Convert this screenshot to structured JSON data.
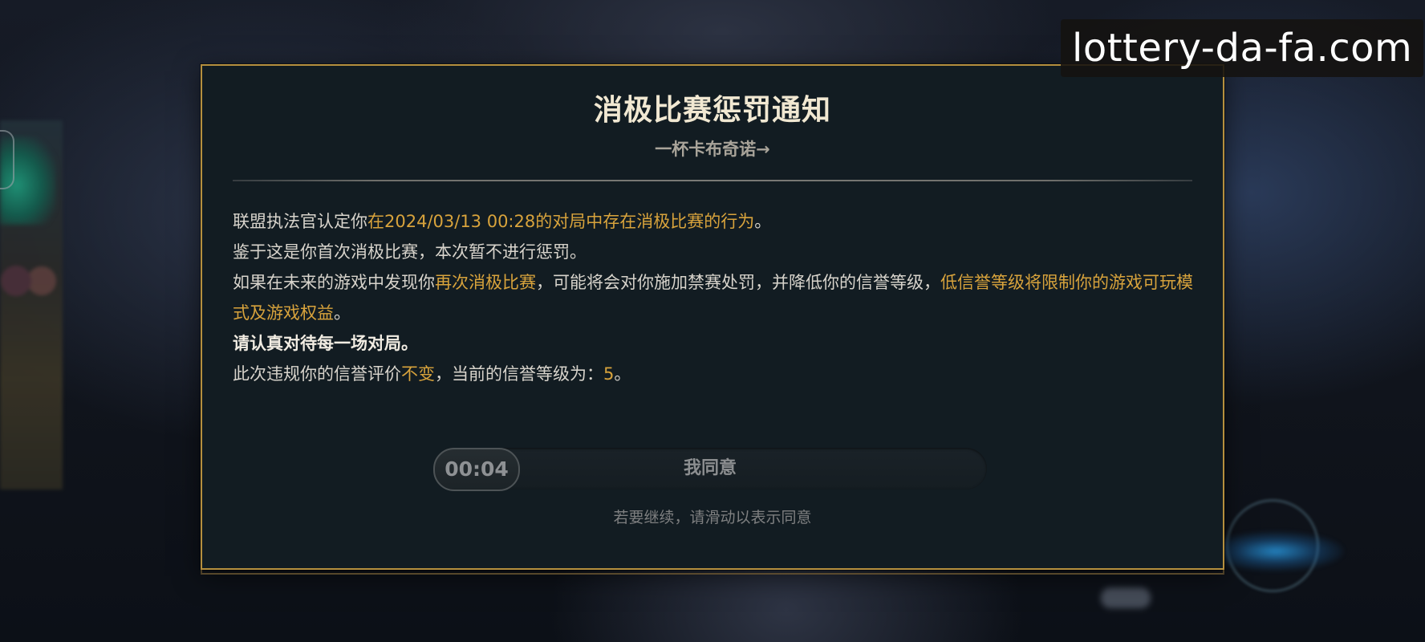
{
  "watermark": {
    "text": "lottery-da-fa.com"
  },
  "dialog": {
    "title": "消极比赛惩罚通知",
    "subtitle": "一杯卡布奇诺→",
    "body": {
      "line1": {
        "prefix": "联盟执法官认定你",
        "highlight": "在2024/03/13 00:28的对局中存在消极比赛的行为",
        "suffix": "。"
      },
      "line2": "鉴于这是你首次消极比赛，本次暂不进行惩罚。",
      "line3": {
        "prefix": "如果在未来的游戏中发现你",
        "highlight1": "再次消极比赛",
        "middle": "，可能将会对你施加禁赛处罚，并降低你的信誉等级，",
        "highlight2": "低信誉等级将限制你的游戏可玩模式及游戏权益",
        "suffix": "。"
      },
      "line4": "请认真对待每一场对局。",
      "line5": {
        "prefix": "此次违规你的信誉评价",
        "highlight1": "不变",
        "middle": "，当前的信誉等级为：",
        "highlight2": "5",
        "suffix": "。"
      }
    },
    "slider": {
      "timer": "00:04",
      "label": "我同意",
      "hint": "若要继续，请滑动以表示同意"
    }
  },
  "colors": {
    "highlight": "#d8a33c",
    "border": "#b58f3e",
    "panel": "#121c22"
  }
}
